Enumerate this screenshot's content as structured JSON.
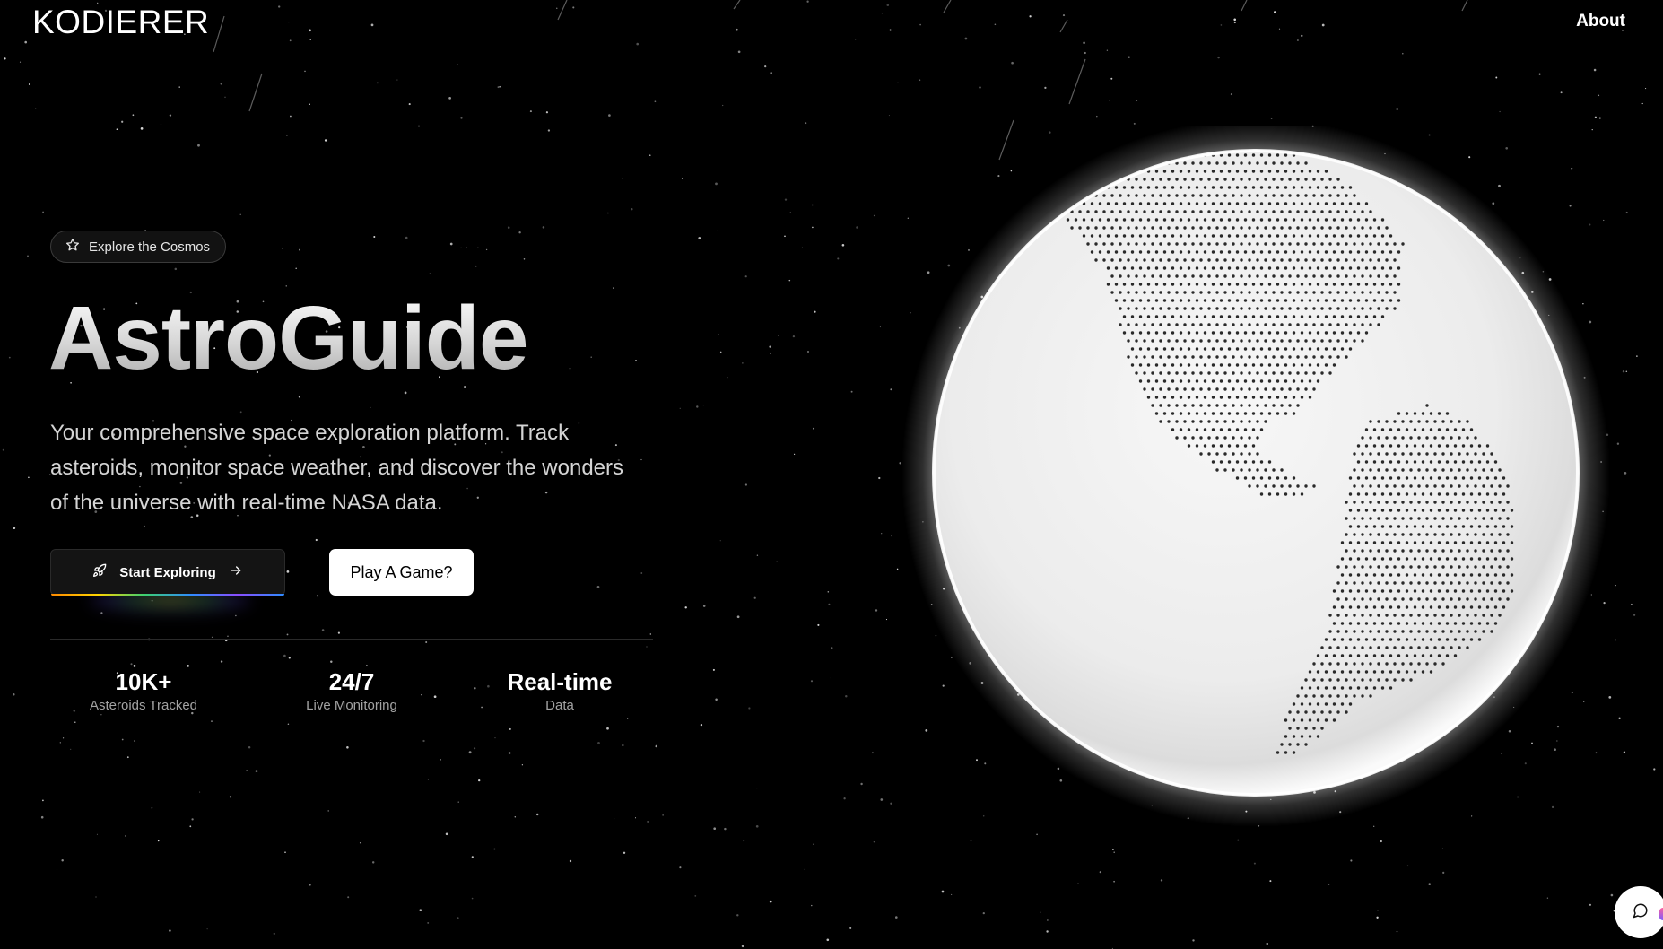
{
  "header": {
    "logo": "KODIERER",
    "nav_about": "About"
  },
  "hero": {
    "badge_label": "Explore the Cosmos",
    "badge_icon": "star-icon",
    "title": "AstroGuide",
    "description": "Your comprehensive space exploration platform. Track asteroids, monitor space weather, and discover the wonders of the universe with real-time NASA data.",
    "primary_button": {
      "label": "Start Exploring",
      "icon": "rocket-icon",
      "trailing_icon": "arrow-right-icon"
    },
    "secondary_button": {
      "label": "Play A Game?"
    }
  },
  "stats": [
    {
      "value": "10K+",
      "label": "Asteroids Tracked"
    },
    {
      "value": "24/7",
      "label": "Live Monitoring"
    },
    {
      "value": "Real-time",
      "label": "Data"
    }
  ],
  "chat_widget": {
    "icon": "chat-bubble-icon"
  },
  "colors": {
    "background": "#000000",
    "globe": "#f0f0f0",
    "land_dots": "#2a2a2a",
    "primary_button_bg": "#141414",
    "secondary_button_bg": "#ffffff"
  }
}
